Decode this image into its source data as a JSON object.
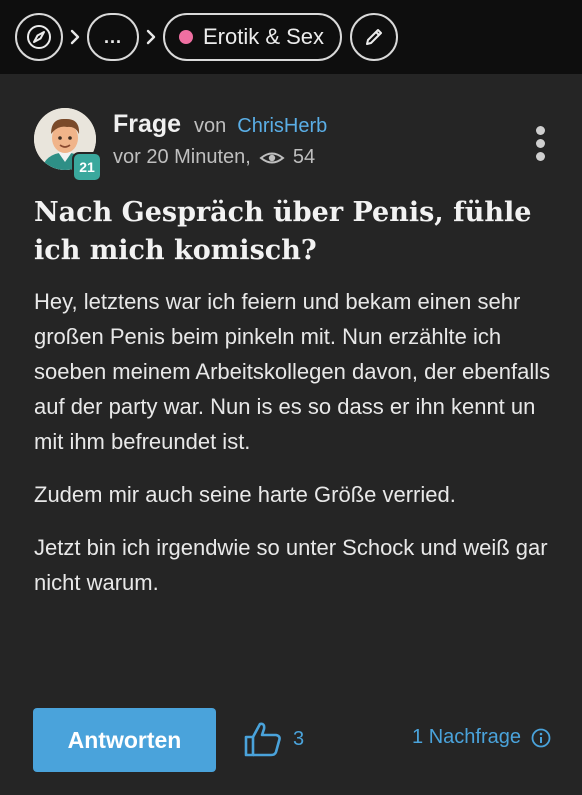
{
  "breadcrumb": {
    "more_label": "...",
    "category_label": "Erotik & Sex",
    "category_dot_color": "#ef6fa1"
  },
  "question": {
    "type_label": "Frage",
    "von_label": "von",
    "author": "ChrisHerb",
    "author_level": "21",
    "time": "vor 20 Minuten,",
    "views": "54",
    "title": "Nach Gespräch über Penis, fühle ich mich komisch?",
    "paragraphs": [
      "Hey, letztens war ich feiern und bekam einen sehr großen Penis beim pinkeln mit. Nun erzählte ich soeben meinem Arbeitskollegen davon, der ebenfalls auf der party war. Nun is es so dass er ihn kennt un mit ihm befreundet ist.",
      "Zudem mir auch seine harte Größe verried.",
      "Jetzt bin ich irgendwie so unter Schock und weiß gar nicht warum."
    ]
  },
  "actions": {
    "answer_label": "Antworten",
    "like_count": "3",
    "nachfrage_label": "1 Nachfrage"
  },
  "colors": {
    "accent": "#4aa3db",
    "card": "#252525",
    "badge": "#3aa89d"
  }
}
